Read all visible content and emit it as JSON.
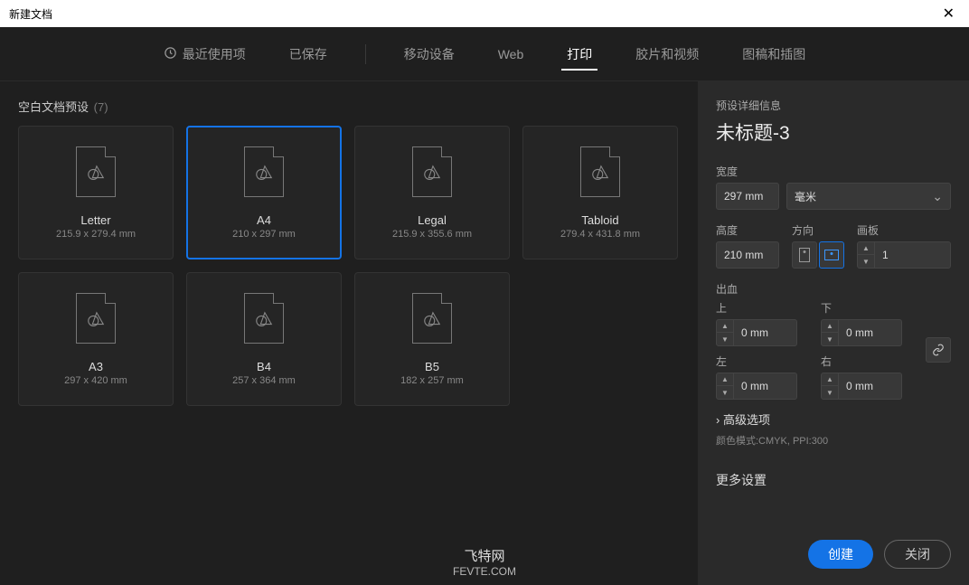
{
  "window": {
    "title": "新建文档"
  },
  "tabs": {
    "recent": "最近使用项",
    "saved": "已保存",
    "mobile": "移动设备",
    "web": "Web",
    "print": "打印",
    "film": "胶片和视频",
    "art": "图稿和插图"
  },
  "section": {
    "title": "空白文档预设",
    "count": "(7)"
  },
  "presets": [
    {
      "name": "Letter",
      "dims": "215.9 x 279.4 mm"
    },
    {
      "name": "A4",
      "dims": "210 x 297 mm"
    },
    {
      "name": "Legal",
      "dims": "215.9 x 355.6 mm"
    },
    {
      "name": "Tabloid",
      "dims": "279.4 x 431.8 mm"
    },
    {
      "name": "A3",
      "dims": "297 x 420 mm"
    },
    {
      "name": "B4",
      "dims": "257 x 364 mm"
    },
    {
      "name": "B5",
      "dims": "182 x 257 mm"
    }
  ],
  "panel": {
    "heading": "预设详细信息",
    "docname": "未标题-3",
    "widthLabel": "宽度",
    "width": "297 mm",
    "unit": "毫米",
    "heightLabel": "高度",
    "height": "210 mm",
    "orientLabel": "方向",
    "artboardLabel": "画板",
    "artboards": "1",
    "bleedLabel": "出血",
    "topLabel": "上",
    "bottomLabel": "下",
    "leftLabel": "左",
    "rightLabel": "右",
    "top": "0 mm",
    "bottom": "0 mm",
    "left": "0 mm",
    "rightv": "0 mm",
    "advanced": "高级选项",
    "mode": "颜色模式:CMYK, PPI:300",
    "more": "更多设置",
    "create": "创建",
    "close": "关闭"
  },
  "watermark": {
    "t1": "飞特网",
    "t2": "FEVTE.COM"
  }
}
